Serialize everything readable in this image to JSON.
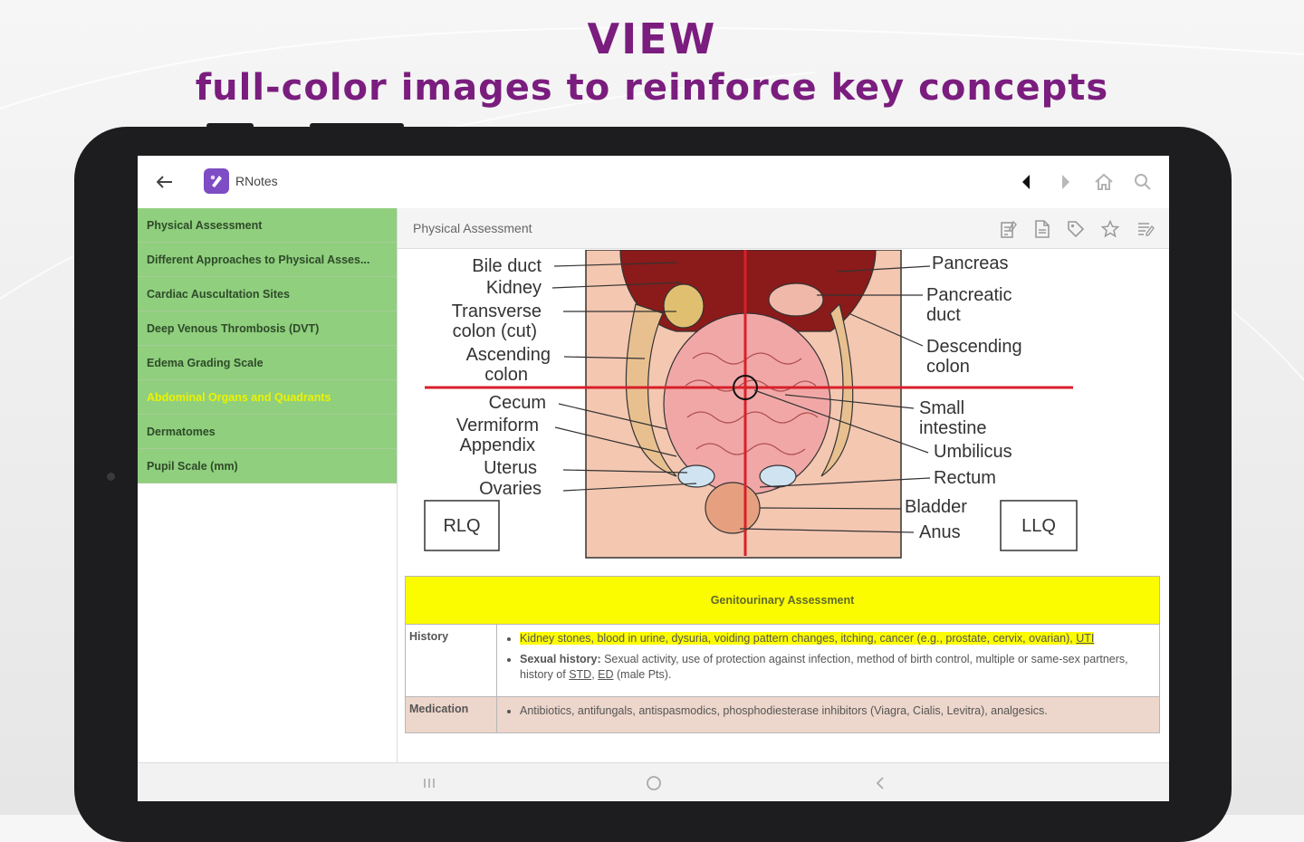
{
  "promo": {
    "headline": "VIEW",
    "subheadline": "full-color images to reinforce key concepts"
  },
  "colors": {
    "brand": "#7a1d7e",
    "sidebar": "#8fcf7e",
    "highlight": "#fcfc00",
    "quadrant_line": "#d8202a"
  },
  "appbar": {
    "back_icon": "arrow-left-icon",
    "app_name": "RNotes",
    "icons": [
      "caret-left-icon",
      "caret-right-icon",
      "home-icon",
      "search-icon"
    ]
  },
  "sidebar": {
    "items": [
      {
        "label": "Physical Assessment"
      },
      {
        "label": "Different Approaches to Physical Asses..."
      },
      {
        "label": "Cardiac Auscultation Sites"
      },
      {
        "label": "Deep Venous Thrombosis (DVT)"
      },
      {
        "label": "Edema Grading Scale"
      },
      {
        "label": "Abdominal Organs and Quadrants"
      },
      {
        "label": "Dermatomes"
      },
      {
        "label": "Pupil Scale (mm)"
      }
    ],
    "active_index": 5
  },
  "content": {
    "title": "Physical Assessment",
    "toolbar_icons": [
      "notes-icon",
      "document-icon",
      "tag-icon",
      "star-icon",
      "list-edit-icon"
    ]
  },
  "figure": {
    "left_labels": [
      "Bile duct",
      "Kidney",
      "Transverse",
      "colon (cut)",
      "Ascending",
      "colon",
      "Cecum",
      "Vermiform",
      "Appendix",
      "Uterus",
      "Ovaries"
    ],
    "right_labels": [
      "Pancreas",
      "Pancreatic",
      "duct",
      "Descending",
      "colon",
      "Small",
      "intestine",
      "Umbilicus",
      "Rectum",
      "Bladder",
      "Anus"
    ],
    "quadrants": [
      "RLQ",
      "LLQ"
    ]
  },
  "table": {
    "heading": "Genitourinary Assessment",
    "history_label": "History",
    "history_b1_text": "Kidney stones, blood in urine, dysuria, voiding pattern changes, itching, cancer (e.g., prostate, cervix, ovarian), ",
    "history_b1_link": "UTI",
    "history_b2_bold": "Sexual history:",
    "history_b2_text": " Sexual activity, use of protection against infection, method of birth control, multiple or same-sex partners, history of ",
    "history_b2_link1": "STD",
    "history_b2_sep": ", ",
    "history_b2_link2": "ED",
    "history_b2_end": " (male Pts).",
    "medication_label": "Medication",
    "medication_text": "Antibiotics, antifungals, antispasmodics, phosphodiesterase inhibitors (Viagra, Cialis, Levitra), analgesics."
  },
  "navbar": {
    "icons": [
      "recents-icon",
      "home-circle-icon",
      "back-icon"
    ]
  }
}
